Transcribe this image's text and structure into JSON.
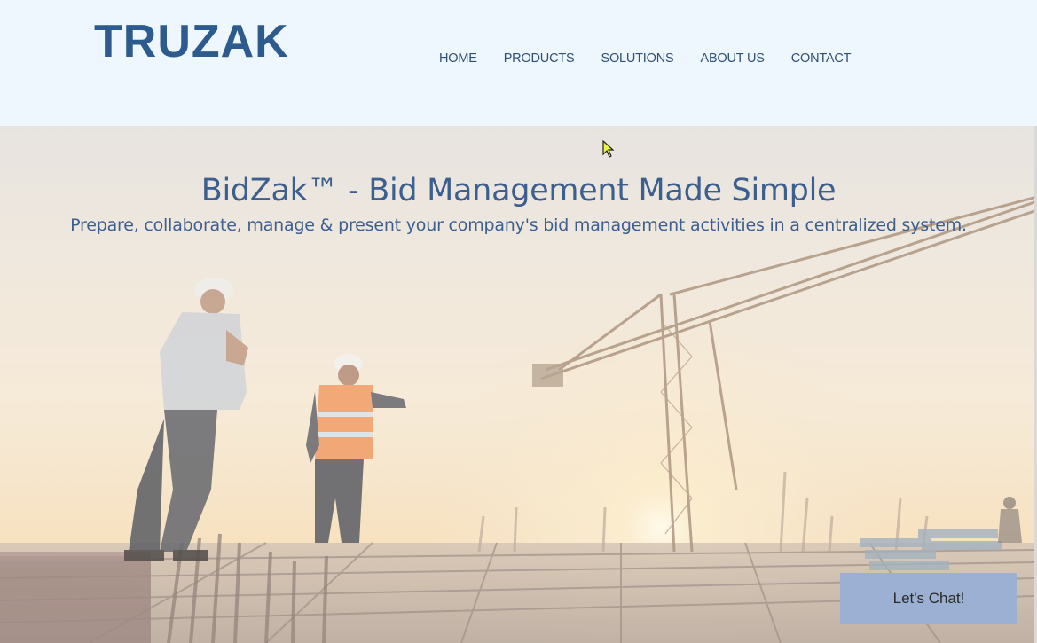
{
  "header": {
    "logo": "TRUZAK",
    "nav": [
      "HOME",
      "PRODUCTS",
      "SOLUTIONS",
      "ABOUT US",
      "CONTACT"
    ]
  },
  "hero": {
    "title": "BidZak™ - Bid Management Made Simple",
    "subtitle": "Prepare, collaborate, manage & present your company's bid management activities in a centralized system."
  },
  "chat": {
    "label": "Let's Chat!"
  },
  "colors": {
    "header_bg": "#eef6fe",
    "brand": "#2e5b8e",
    "nav_text": "#2f4f75",
    "hero_text": "#3d5f8f",
    "chat_button": "#9bb0d2"
  },
  "icons": {
    "cursor": "mouse-pointer-icon"
  }
}
